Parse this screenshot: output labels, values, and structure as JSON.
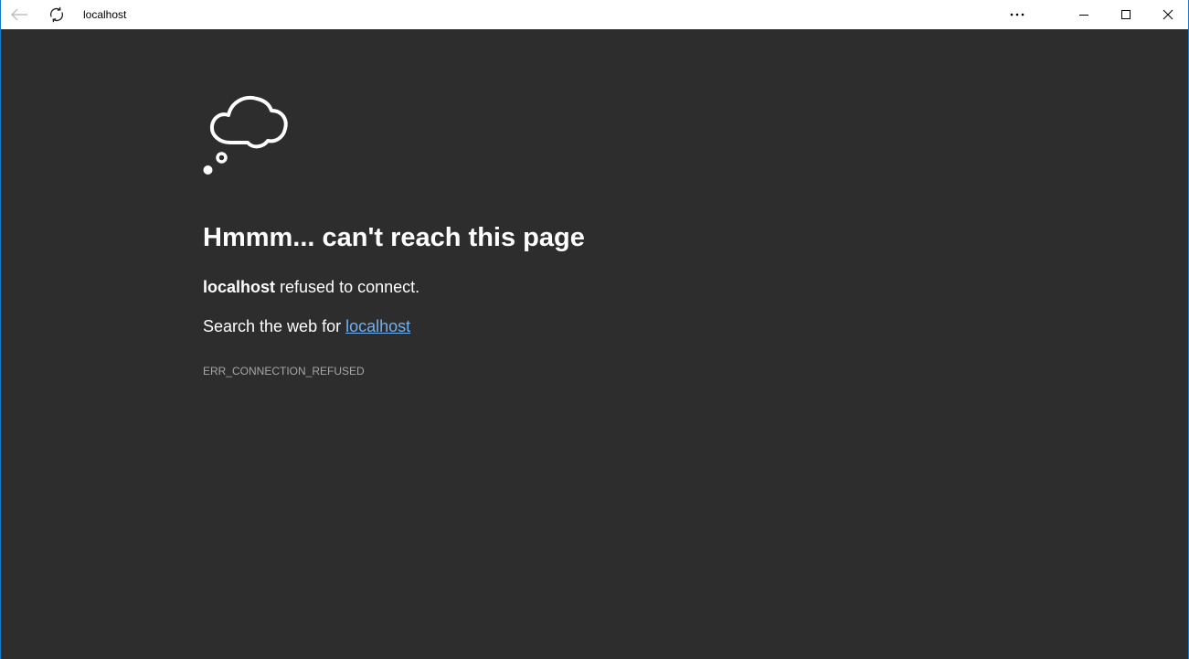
{
  "titlebar": {
    "address": "localhost",
    "icons": {
      "back": "back-arrow-icon",
      "refresh": "refresh-icon",
      "more": "more-ellipsis-icon",
      "minimize": "minimize-icon",
      "maximize": "maximize-icon",
      "close": "close-icon"
    }
  },
  "error": {
    "icon": "thought-cloud-icon",
    "heading": "Hmmm... can't reach this page",
    "host": "localhost",
    "message": "refused to connect.",
    "search_prefix": "Search the web for",
    "search_link": "localhost",
    "code": "ERR_CONNECTION_REFUSED"
  },
  "colors": {
    "background": "#2d2d2d",
    "titlebar": "#ffffff",
    "link": "#6fb1f2",
    "window_border": "#1979ca",
    "error_code": "#a6a6a6"
  }
}
